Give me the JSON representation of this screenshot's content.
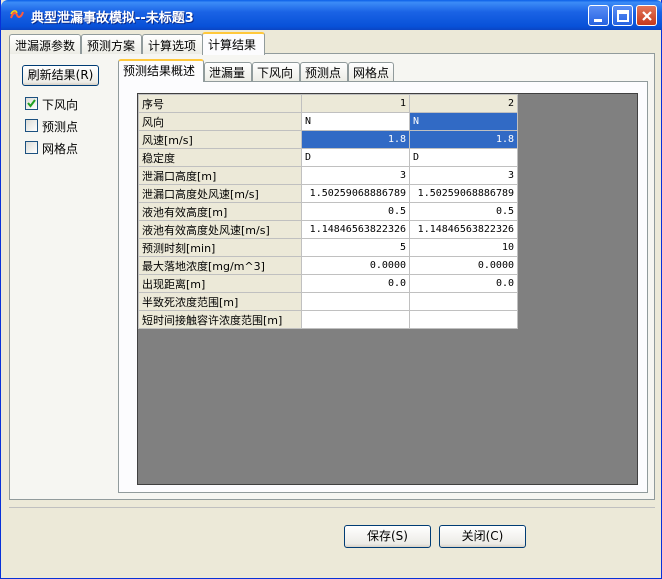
{
  "window": {
    "title": "典型泄漏事故模拟--未标题3"
  },
  "main_tabs": [
    {
      "label": "泄漏源参数"
    },
    {
      "label": "预测方案"
    },
    {
      "label": "计算选项"
    },
    {
      "label": "计算结果"
    }
  ],
  "left_panel": {
    "refresh_label": "刷新结果(R)",
    "checkboxes": [
      {
        "label": "下风向",
        "checked": true
      },
      {
        "label": "预测点",
        "checked": false
      },
      {
        "label": "网格点",
        "checked": false
      }
    ]
  },
  "sub_tabs": [
    {
      "label": "预测结果概述"
    },
    {
      "label": "泄漏量"
    },
    {
      "label": "下风向"
    },
    {
      "label": "预测点"
    },
    {
      "label": "网格点"
    }
  ],
  "grid": {
    "columns": [
      "1",
      "2"
    ],
    "rows": [
      {
        "label": "序号",
        "v1": "1",
        "v2": "2"
      },
      {
        "label": "风向",
        "v1": "N",
        "v2": "N"
      },
      {
        "label": "风速[m/s]",
        "v1": "1.8",
        "v2": "1.8"
      },
      {
        "label": "稳定度",
        "v1": "D",
        "v2": "D"
      },
      {
        "label": "泄漏口高度[m]",
        "v1": "3",
        "v2": "3"
      },
      {
        "label": "泄漏口高度处风速[m/s]",
        "v1": "1.50259068886789",
        "v2": "1.50259068886789"
      },
      {
        "label": "液池有效高度[m]",
        "v1": "0.5",
        "v2": "0.5"
      },
      {
        "label": "液池有效高度处风速[m/s]",
        "v1": "1.14846563822326",
        "v2": "1.14846563822326"
      },
      {
        "label": "预测时刻[min]",
        "v1": "5",
        "v2": "10"
      },
      {
        "label": "最大落地浓度[mg/m^3]",
        "v1": "0.0000",
        "v2": "0.0000"
      },
      {
        "label": "出现距离[m]",
        "v1": "0.0",
        "v2": "0.0"
      },
      {
        "label": "半致死浓度范围[m]",
        "v1": "",
        "v2": ""
      },
      {
        "label": "短时间接触容许浓度范围[m]",
        "v1": "",
        "v2": ""
      }
    ]
  },
  "footer": {
    "save_label": "保存(S)",
    "close_label": "关闭(C)"
  },
  "colors": {
    "titlebar": "#0A5FE8",
    "selection": "#316AC5",
    "grid_background": "#808080"
  }
}
